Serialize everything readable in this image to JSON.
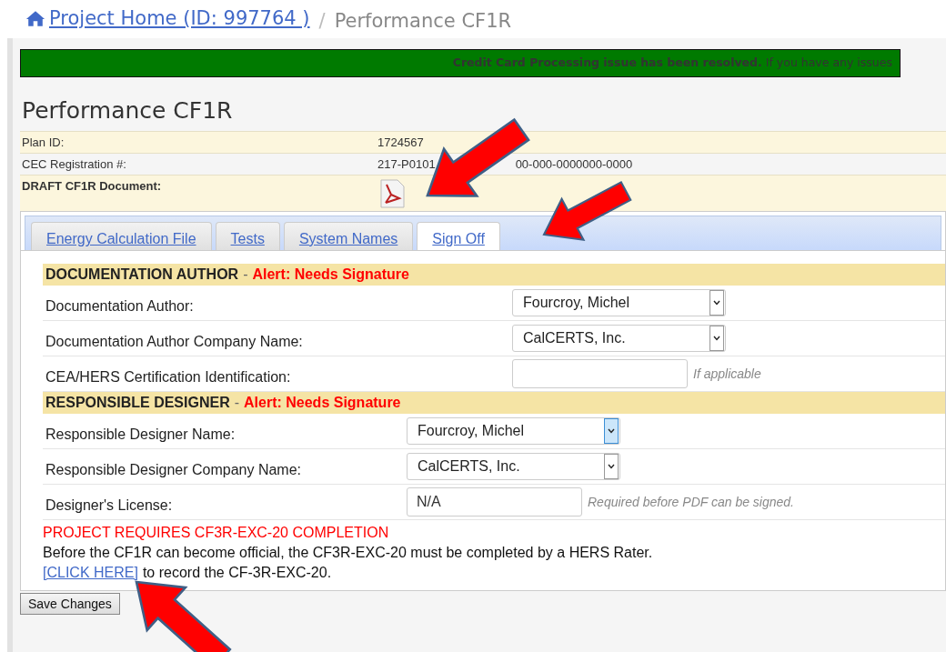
{
  "breadcrumb": {
    "home_link": "Project Home (ID: 997764 )",
    "separator": "/",
    "current": "Performance CF1R"
  },
  "banner": {
    "message": "**Credit Card Processing issue has been resolved.** If you have any issues"
  },
  "page_title": "Performance CF1R",
  "info_rows": [
    {
      "kind": "text",
      "label": "Plan ID:",
      "value": "1724567"
    },
    {
      "kind": "split",
      "label": "CEC Registration #:",
      "value_parts": [
        "217-P0101",
        "00-000-0000000-0000"
      ]
    },
    {
      "kind": "document",
      "label": "DRAFT CF1R Document:"
    }
  ],
  "tabs": [
    {
      "label": "Energy Calculation File",
      "selected": false
    },
    {
      "label": "Tests",
      "selected": false
    },
    {
      "label": "System Names",
      "selected": false
    },
    {
      "label": "Sign Off",
      "selected": true
    }
  ],
  "sections": [
    {
      "title": "DOCUMENTATION AUTHOR",
      "separator": "-",
      "alert": "Alert: Needs Signature",
      "fields": [
        {
          "kind": "select",
          "label": "Documentation Author:",
          "value": "Fourcroy, Michel",
          "focused": false
        },
        {
          "kind": "select",
          "label": "Documentation Author Company Name:",
          "value": "CalCERTS, Inc.",
          "focused": false
        },
        {
          "kind": "input",
          "label": "CEA/HERS Certification Identification:",
          "hint": "If applicable"
        }
      ]
    },
    {
      "title": "RESPONSIBLE DESIGNER",
      "separator": "-",
      "alert": "Alert: Needs Signature",
      "fields": [
        {
          "kind": "select",
          "label": "Responsible Designer Name:",
          "value": "Fourcroy, Michel",
          "focused": true
        },
        {
          "kind": "select",
          "label": "Responsible Designer Company Name:",
          "value": "CalCERTS, Inc.",
          "focused": false
        },
        {
          "kind": "input",
          "label": "Designer's License:",
          "value": "N/A",
          "hint": "Required before PDF can be signed."
        }
      ]
    }
  ],
  "notice": {
    "heading": "PROJECT REQUIRES CF3R-EXC-20 COMPLETION",
    "text": "Before the CF1R can become official, the CF3R-EXC-20 must be completed by a HERS Rater.",
    "link": "[CLICK HERE]",
    "link_suffix": "to record the CF-3R-EXC-20."
  },
  "save_button": "Save Changes"
}
